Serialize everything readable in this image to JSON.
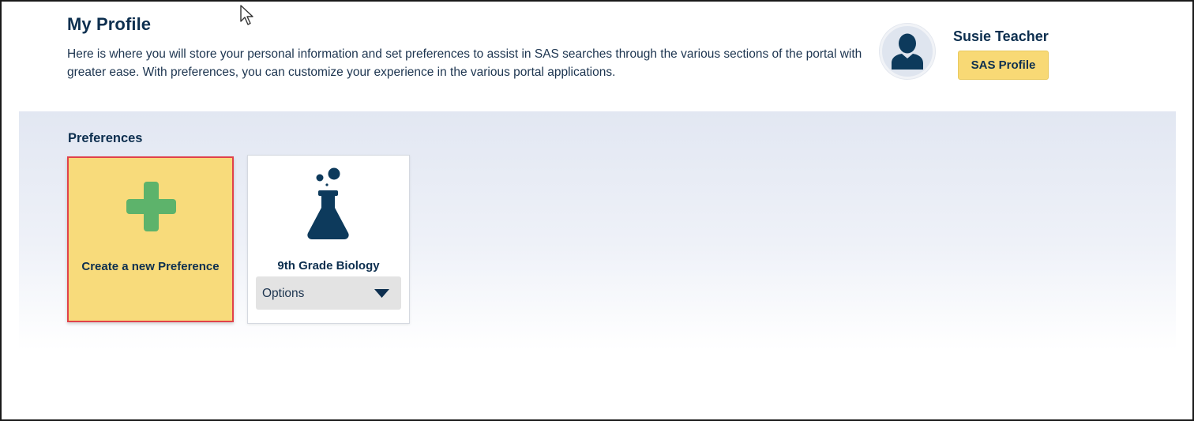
{
  "header": {
    "title": "My Profile",
    "description": "Here is where you will store your personal information and set preferences to assist in SAS searches through the various sections of the portal with greater ease. With preferences, you can customize your experience in the various portal applications."
  },
  "user": {
    "name": "Susie Teacher",
    "avatar_icon": "user-avatar-icon",
    "profile_button_label": "SAS Profile"
  },
  "preferences": {
    "section_title": "Preferences",
    "create_card": {
      "label": "Create a new Preference",
      "icon": "plus-icon",
      "icon_color": "#5db36b",
      "highlight_border": "#e1424a"
    },
    "items": [
      {
        "name": "9th Grade Biology",
        "icon": "flask-icon",
        "options_label": "Options",
        "options_icon": "caret-down-icon"
      }
    ]
  },
  "colors": {
    "primary_text": "#0d2f4f",
    "accent_yellow": "#f8d975",
    "section_bg": "#e2e7f2"
  }
}
